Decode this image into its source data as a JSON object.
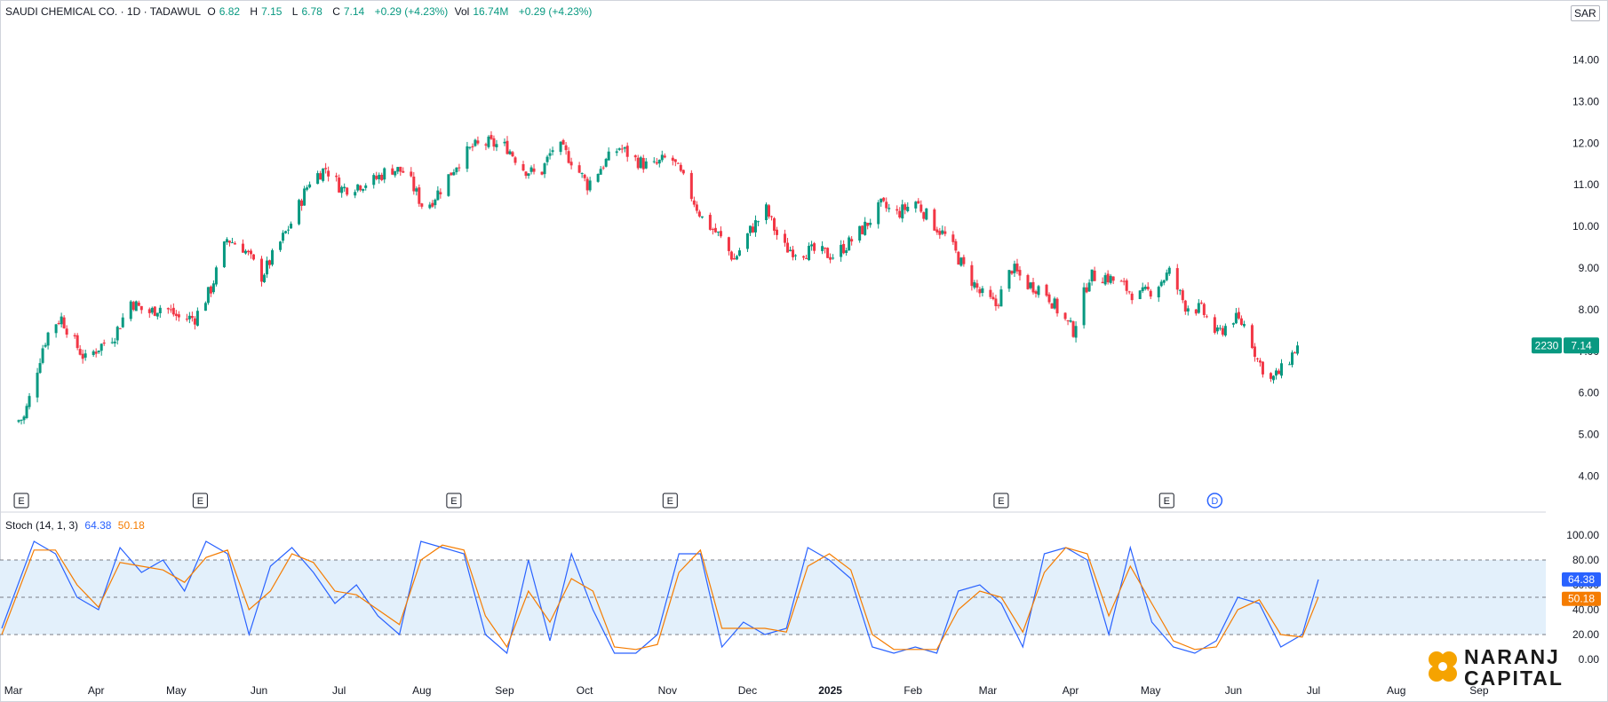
{
  "legend": {
    "symbol": "SAUDI CHEMICAL CO. · 1D · TADAWUL",
    "o_label": "O",
    "o_value": "6.82",
    "h_label": "H",
    "h_value": "7.15",
    "l_label": "L",
    "l_value": "6.78",
    "c_label": "C",
    "c_value": "7.14",
    "change": "+0.29 (+4.23%)",
    "vol_label": "Vol",
    "vol_value": "16.74M",
    "vol_change": "+0.29 (+4.23%)"
  },
  "currency": "SAR",
  "last_price_badge": {
    "ticker": "2230",
    "price": "7.14"
  },
  "stoch_legend": {
    "label": "Stoch (14, 1, 3)",
    "k_value": "64.38",
    "d_value": "50.18"
  },
  "stoch_badges": {
    "k": "64.38",
    "d": "50.18"
  },
  "earnings_marker": "E",
  "dividend_marker": "D",
  "logo": {
    "line1": "NARANJ",
    "line2": "CAPITAL"
  },
  "colors": {
    "up": "#089981",
    "down": "#f23645",
    "k_line": "#2962ff",
    "d_line": "#f57c00",
    "band": "#e3f0fb"
  },
  "chart_data": [
    {
      "type": "candlestick",
      "y_axis_labels": [
        "14.00",
        "13.00",
        "12.00",
        "11.00",
        "10.00",
        "9.00",
        "8.00",
        "7.00",
        "6.00",
        "5.00",
        "4.00"
      ],
      "ylim": [
        3.5,
        14.8
      ],
      "x_axis_labels": [
        "Mar",
        "Apr",
        "May",
        "Jun",
        "Jul",
        "Aug",
        "Sep",
        "Oct",
        "Nov",
        "Dec",
        "2025",
        "Feb",
        "Mar",
        "Apr",
        "May",
        "Jun",
        "Jul",
        "Aug",
        "Sep"
      ],
      "close_path": [
        [
          "2024-03-01",
          5.3
        ],
        [
          "2024-03-05",
          5.4
        ],
        [
          "2024-03-08",
          6.1
        ],
        [
          "2024-03-12",
          7.1
        ],
        [
          "2024-03-15",
          7.6
        ],
        [
          "2024-03-19",
          7.8
        ],
        [
          "2024-03-24",
          7.2
        ],
        [
          "2024-03-28",
          6.8
        ],
        [
          "2024-04-02",
          7.1
        ],
        [
          "2024-04-08",
          7.4
        ],
        [
          "2024-04-14",
          8.2
        ],
        [
          "2024-04-20",
          7.9
        ],
        [
          "2024-04-26",
          8.1
        ],
        [
          "2024-05-02",
          7.8
        ],
        [
          "2024-05-08",
          7.8
        ],
        [
          "2024-05-14",
          8.5
        ],
        [
          "2024-05-20",
          9.7
        ],
        [
          "2024-05-26",
          9.5
        ],
        [
          "2024-06-02",
          8.8
        ],
        [
          "2024-06-08",
          9.5
        ],
        [
          "2024-06-14",
          10.2
        ],
        [
          "2024-06-20",
          11.1
        ],
        [
          "2024-06-26",
          11.4
        ],
        [
          "2024-07-02",
          10.9
        ],
        [
          "2024-07-08",
          11.0
        ],
        [
          "2024-07-14",
          11.1
        ],
        [
          "2024-07-20",
          11.4
        ],
        [
          "2024-07-26",
          11.3
        ],
        [
          "2024-08-02",
          10.4
        ],
        [
          "2024-08-08",
          10.9
        ],
        [
          "2024-08-14",
          11.5
        ],
        [
          "2024-08-20",
          11.9
        ],
        [
          "2024-08-26",
          12.0
        ],
        [
          "2024-09-02",
          11.9
        ],
        [
          "2024-09-08",
          11.4
        ],
        [
          "2024-09-14",
          11.2
        ],
        [
          "2024-09-20",
          12.0
        ],
        [
          "2024-09-26",
          11.6
        ],
        [
          "2024-10-02",
          11.0
        ],
        [
          "2024-10-08",
          11.5
        ],
        [
          "2024-10-14",
          11.9
        ],
        [
          "2024-10-20",
          11.6
        ],
        [
          "2024-10-26",
          11.4
        ],
        [
          "2024-11-02",
          11.7
        ],
        [
          "2024-11-08",
          11.0
        ],
        [
          "2024-11-14",
          10.2
        ],
        [
          "2024-11-20",
          9.8
        ],
        [
          "2024-11-26",
          9.2
        ],
        [
          "2024-12-02",
          9.9
        ],
        [
          "2024-12-08",
          10.4
        ],
        [
          "2024-12-14",
          9.5
        ],
        [
          "2024-12-20",
          9.4
        ],
        [
          "2024-12-26",
          9.4
        ],
        [
          "2025-01-02",
          9.3
        ],
        [
          "2025-01-08",
          9.6
        ],
        [
          "2025-01-14",
          10.0
        ],
        [
          "2025-01-20",
          10.5
        ],
        [
          "2025-01-26",
          10.3
        ],
        [
          "2025-02-02",
          10.6
        ],
        [
          "2025-02-08",
          10.1
        ],
        [
          "2025-02-14",
          9.7
        ],
        [
          "2025-02-20",
          9.0
        ],
        [
          "2025-02-26",
          8.4
        ],
        [
          "2025-03-04",
          8.1
        ],
        [
          "2025-03-10",
          9.0
        ],
        [
          "2025-03-16",
          8.6
        ],
        [
          "2025-03-22",
          8.5
        ],
        [
          "2025-03-28",
          7.9
        ],
        [
          "2025-04-02",
          7.5
        ],
        [
          "2025-04-08",
          8.8
        ],
        [
          "2025-04-14",
          8.8
        ],
        [
          "2025-04-20",
          8.6
        ],
        [
          "2025-04-26",
          8.3
        ],
        [
          "2025-05-02",
          8.5
        ],
        [
          "2025-05-08",
          8.9
        ],
        [
          "2025-05-14",
          8.1
        ],
        [
          "2025-05-20",
          8.0
        ],
        [
          "2025-05-26",
          7.4
        ],
        [
          "2025-06-01",
          7.8
        ],
        [
          "2025-06-06",
          7.6
        ],
        [
          "2025-06-10",
          6.8
        ],
        [
          "2025-06-15",
          6.3
        ],
        [
          "2025-06-20",
          6.6
        ],
        [
          "2025-06-25",
          7.14
        ]
      ],
      "last_close": 7.14
    },
    {
      "type": "line",
      "title": "Stoch (14, 1, 3)",
      "y_axis_labels": [
        "100.00",
        "80.00",
        "60.00",
        "40.00",
        "20.00",
        "0.00"
      ],
      "ylim": [
        -5,
        105
      ],
      "band": [
        20,
        80
      ],
      "series": [
        {
          "name": "%K",
          "values": [
            [
              0,
              25
            ],
            [
              6,
              95
            ],
            [
              10,
              85
            ],
            [
              14,
              50
            ],
            [
              18,
              40
            ],
            [
              22,
              90
            ],
            [
              26,
              70
            ],
            [
              30,
              80
            ],
            [
              34,
              55
            ],
            [
              38,
              95
            ],
            [
              42,
              85
            ],
            [
              46,
              20
            ],
            [
              50,
              75
            ],
            [
              54,
              90
            ],
            [
              58,
              70
            ],
            [
              62,
              45
            ],
            [
              66,
              60
            ],
            [
              70,
              35
            ],
            [
              74,
              20
            ],
            [
              78,
              95
            ],
            [
              82,
              90
            ],
            [
              86,
              85
            ],
            [
              90,
              20
            ],
            [
              94,
              5
            ],
            [
              98,
              80
            ],
            [
              102,
              15
            ],
            [
              106,
              85
            ],
            [
              110,
              40
            ],
            [
              114,
              5
            ],
            [
              118,
              5
            ],
            [
              122,
              20
            ],
            [
              126,
              85
            ],
            [
              130,
              85
            ],
            [
              134,
              10
            ],
            [
              138,
              30
            ],
            [
              142,
              20
            ],
            [
              146,
              25
            ],
            [
              150,
              90
            ],
            [
              154,
              80
            ],
            [
              158,
              65
            ],
            [
              162,
              10
            ],
            [
              166,
              5
            ],
            [
              170,
              10
            ],
            [
              174,
              5
            ],
            [
              178,
              55
            ],
            [
              182,
              60
            ],
            [
              186,
              45
            ],
            [
              190,
              10
            ],
            [
              194,
              85
            ],
            [
              198,
              90
            ],
            [
              202,
              80
            ],
            [
              206,
              20
            ],
            [
              210,
              90
            ],
            [
              214,
              30
            ],
            [
              218,
              10
            ],
            [
              222,
              5
            ],
            [
              226,
              15
            ],
            [
              230,
              50
            ],
            [
              234,
              45
            ],
            [
              238,
              10
            ],
            [
              242,
              20
            ],
            [
              245,
              64.38
            ]
          ]
        },
        {
          "name": "%D",
          "values": [
            [
              0,
              20
            ],
            [
              6,
              88
            ],
            [
              10,
              88
            ],
            [
              14,
              60
            ],
            [
              18,
              42
            ],
            [
              22,
              78
            ],
            [
              26,
              75
            ],
            [
              30,
              72
            ],
            [
              34,
              62
            ],
            [
              38,
              82
            ],
            [
              42,
              88
            ],
            [
              46,
              40
            ],
            [
              50,
              55
            ],
            [
              54,
              85
            ],
            [
              58,
              78
            ],
            [
              62,
              55
            ],
            [
              66,
              52
            ],
            [
              70,
              40
            ],
            [
              74,
              28
            ],
            [
              78,
              80
            ],
            [
              82,
              92
            ],
            [
              86,
              88
            ],
            [
              90,
              35
            ],
            [
              94,
              10
            ],
            [
              98,
              55
            ],
            [
              102,
              30
            ],
            [
              106,
              65
            ],
            [
              110,
              55
            ],
            [
              114,
              10
            ],
            [
              118,
              8
            ],
            [
              122,
              12
            ],
            [
              126,
              70
            ],
            [
              130,
              88
            ],
            [
              134,
              25
            ],
            [
              138,
              25
            ],
            [
              142,
              25
            ],
            [
              146,
              22
            ],
            [
              150,
              75
            ],
            [
              154,
              85
            ],
            [
              158,
              72
            ],
            [
              162,
              20
            ],
            [
              166,
              8
            ],
            [
              170,
              8
            ],
            [
              174,
              8
            ],
            [
              178,
              40
            ],
            [
              182,
              55
            ],
            [
              186,
              50
            ],
            [
              190,
              22
            ],
            [
              194,
              70
            ],
            [
              198,
              90
            ],
            [
              202,
              85
            ],
            [
              206,
              35
            ],
            [
              210,
              75
            ],
            [
              214,
              45
            ],
            [
              218,
              15
            ],
            [
              222,
              8
            ],
            [
              226,
              10
            ],
            [
              230,
              40
            ],
            [
              234,
              48
            ],
            [
              238,
              20
            ],
            [
              242,
              18
            ],
            [
              245,
              50.18
            ]
          ]
        }
      ]
    }
  ]
}
